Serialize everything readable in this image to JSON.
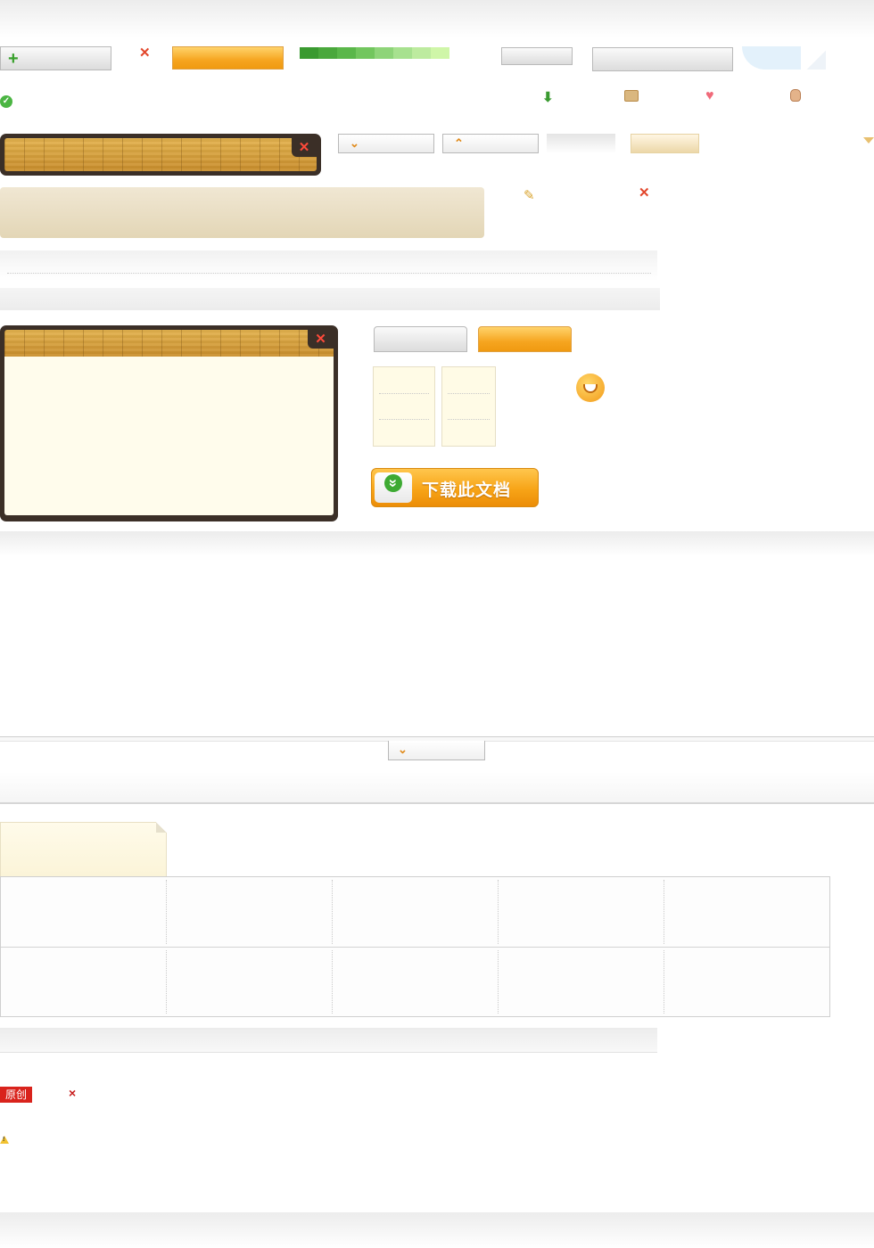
{
  "badges": {
    "original": "原创"
  },
  "download_button": {
    "label": "下载此文档"
  },
  "icons": {
    "plus": "+",
    "close": "✕",
    "check": "✓",
    "download_arrow": "⬇",
    "heart": "♥",
    "chevron_down": "⌄",
    "chevron_up": "⌃",
    "pencil": "✎",
    "warning": "!",
    "small_close": "×",
    "double_chevron": "»"
  },
  "colors": {
    "orange": "#f6a520",
    "beige": "#ece0c3",
    "green_dark": "#3a9a30",
    "green_light": "#cff6a8",
    "wood_frame": "#3b2f27",
    "badge_red": "#d9231c"
  }
}
